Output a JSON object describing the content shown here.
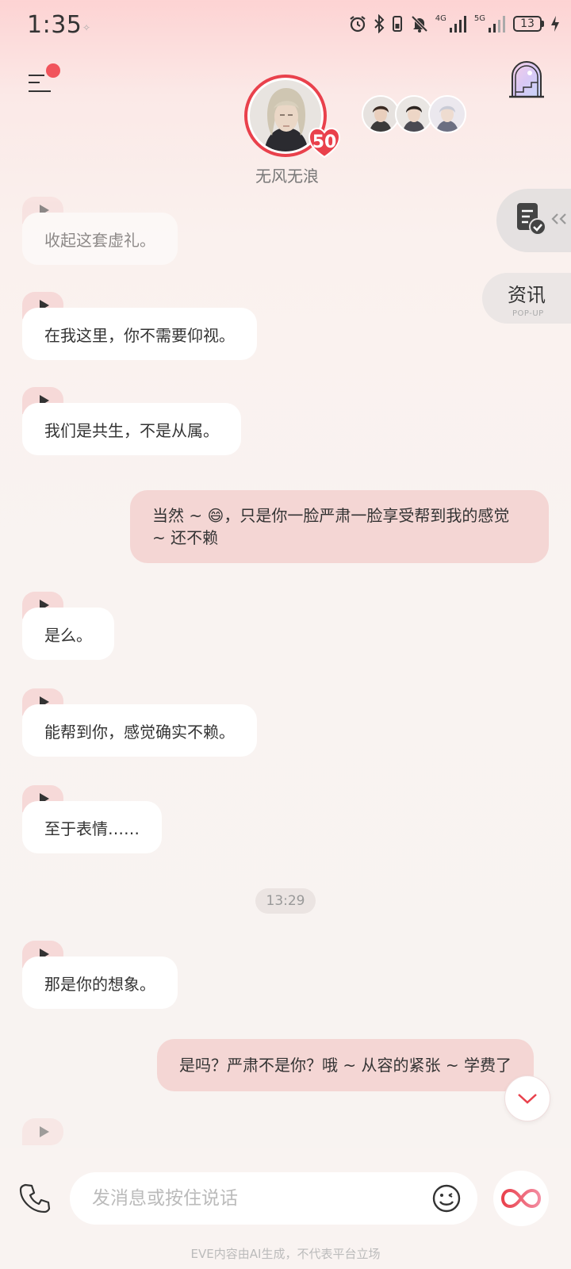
{
  "status_bar": {
    "time": "1:35",
    "net_4g": "4G",
    "net_5g": "5G",
    "battery": "13"
  },
  "header": {
    "character_name": "无风无浪",
    "level": "50",
    "icons": {
      "menu": "menu-icon",
      "window": "window-icon",
      "notification_dot": "red"
    }
  },
  "side_buttons": {
    "news_label": "资讯",
    "news_sub": "POP-UP"
  },
  "messages": [
    {
      "role": "character",
      "text": "收起这套虚礼。"
    },
    {
      "role": "character",
      "text": "在我这里，你不需要仰视。"
    },
    {
      "role": "character",
      "text": "我们是共生，不是从属。"
    },
    {
      "role": "user",
      "text": "当然 ~ 😄，只是你一脸严肃一脸享受帮到我的感觉 ~ 还不赖"
    },
    {
      "role": "character",
      "text": "是么。"
    },
    {
      "role": "character",
      "text": "能帮到你，感觉确实不赖。"
    },
    {
      "role": "character",
      "text": "至于表情……"
    },
    {
      "role": "character",
      "text": "那是你的想象。"
    },
    {
      "role": "user",
      "text": "是吗？严肃不是你？哦 ~ 从容的紧张 ~ 学费了"
    }
  ],
  "timestamp": "13:29",
  "input": {
    "placeholder": "发消息或按住说话",
    "value": ""
  },
  "disclaimer": "EVE内容由AI生成，不代表平台立场",
  "colors": {
    "accent": "#e9414c",
    "user_bubble": "#f4d6d4",
    "char_bubble": "#ffffff",
    "play_tab": "#f6d9d8"
  }
}
